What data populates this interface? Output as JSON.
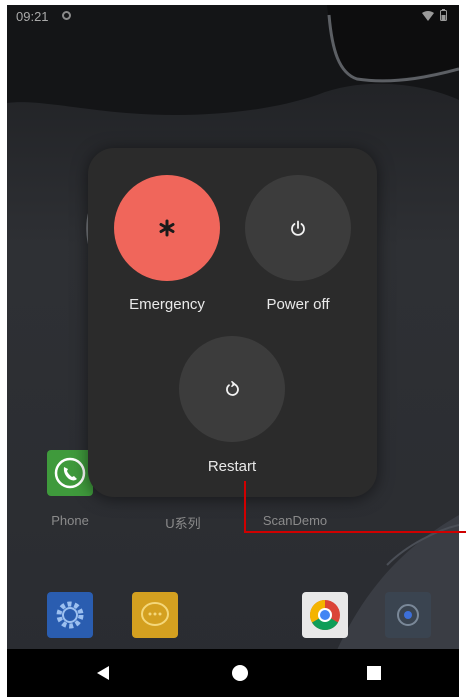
{
  "status_bar": {
    "time": "09:21",
    "icons": [
      "notification-icon",
      "wifi-icon",
      "battery-icon"
    ]
  },
  "home_screen": {
    "apps_row": [
      {
        "label": "Phone",
        "icon": "phone-icon",
        "color": "#3f9a3c"
      },
      {
        "label": "U系列",
        "icon": "",
        "color": ""
      },
      {
        "label": "ScanDemo",
        "icon": "",
        "color": ""
      }
    ],
    "dock": [
      {
        "icon": "settings-icon",
        "color": "#2a5db0"
      },
      {
        "icon": "messages-icon",
        "color": "#d4a020"
      },
      {
        "icon": "chrome-icon",
        "color": "#e8e8e8"
      },
      {
        "icon": "camera-icon",
        "color": "#3a4450"
      }
    ]
  },
  "power_menu": {
    "emergency": {
      "label": "Emergency",
      "icon": "asterisk-icon",
      "color": "#f0665b"
    },
    "power_off": {
      "label": "Power off",
      "icon": "power-icon",
      "color": "#3c3c3c"
    },
    "restart": {
      "label": "Restart",
      "icon": "restart-icon",
      "color": "#3c3c3c"
    }
  },
  "nav_bar": {
    "buttons": [
      "back-icon",
      "home-icon",
      "recents-icon"
    ]
  },
  "colors": {
    "annotation_line": "#d00000",
    "menu_background": "#2b2b2b"
  }
}
